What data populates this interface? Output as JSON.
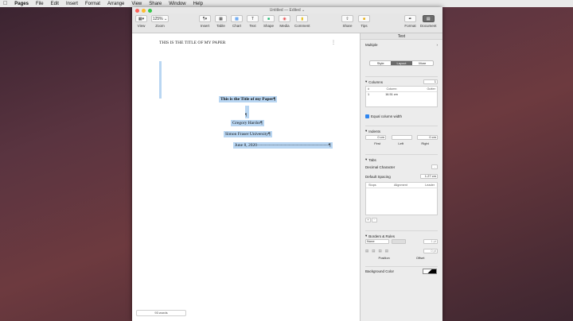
{
  "menubar": {
    "apple": "",
    "app_name": "Pages",
    "items": [
      "File",
      "Edit",
      "Insert",
      "Format",
      "Arrange",
      "View",
      "Share",
      "Window",
      "Help"
    ]
  },
  "window": {
    "title": "Untitled — Edited ⌄"
  },
  "toolbar": {
    "view": "View",
    "zoom_value": "125% ⌄",
    "zoom": "Zoom",
    "insert": "Insert",
    "table": "Table",
    "chart": "Chart",
    "text": "Text",
    "shape": "Shape",
    "media": "Media",
    "comment": "Comment",
    "share": "Share",
    "tips": "Tips",
    "format": "Format",
    "document": "Document"
  },
  "document": {
    "header": "THIS IS THE TITLE OF MY PAPER",
    "title": "This is the Title of my Paper¶",
    "pilcrow": "¶",
    "author": "Gregory Hardor¶",
    "institution": "Simon Fraser University¶",
    "date": "June 8, 2020",
    "word_count": "93 words"
  },
  "inspector": {
    "title": "Text",
    "style_value": "Multiple",
    "tabs": [
      "Style",
      "Layout",
      "More"
    ],
    "active_tab": "Layout",
    "columns": {
      "label": "Columns",
      "value": "1",
      "headers": [
        "#",
        "Column",
        "Gutter"
      ],
      "rows": [
        [
          "1",
          "16.51 cm",
          ""
        ]
      ],
      "equal_label": "Equal column width"
    },
    "indents": {
      "label": "Indents",
      "first": "0 cm",
      "left": "",
      "right": "0 cm",
      "labels": [
        "First",
        "Left",
        "Right"
      ]
    },
    "tabs_section": {
      "label": "Tabs",
      "decimal_label": "Decimal Character",
      "decimal_value": ".",
      "spacing_label": "Default Spacing",
      "spacing_value": "1.27 cm",
      "headers": [
        "Stops",
        "Alignment",
        "Leader"
      ],
      "add": "+",
      "remove": "−"
    },
    "borders": {
      "label": "Borders & Rules",
      "style_value": "None",
      "width_value": "1 pt",
      "offset_value": "0 pt",
      "position_label": "Position",
      "offset_label": "Offset"
    },
    "background": {
      "label": "Background Color"
    }
  },
  "colors": {
    "selection": "#b9d6f2",
    "close": "#fc5f57",
    "minimize": "#fdbc2e",
    "zoom": "#33c748",
    "accent": "#2e86f0"
  }
}
